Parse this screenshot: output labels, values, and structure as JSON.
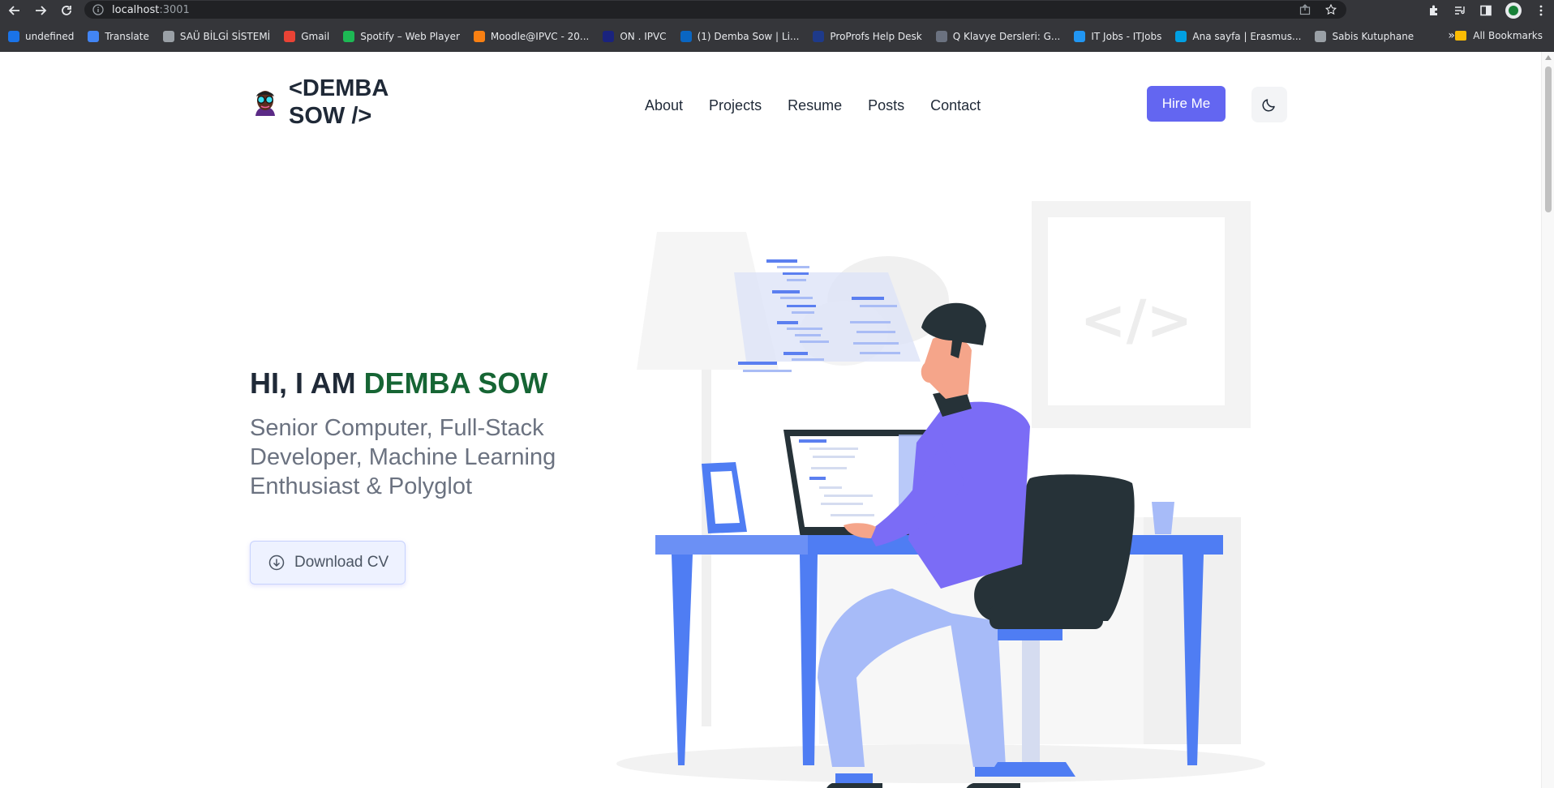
{
  "browser": {
    "url_host": "localhost",
    "url_port": ":3001",
    "bookmarks": [
      {
        "label": "undefined",
        "icon": "infinity-icon",
        "color": "#1a73e8"
      },
      {
        "label": "Translate",
        "icon": "translate-icon",
        "color": "#4285f4"
      },
      {
        "label": "SAÜ BİLGİ SİSTEMİ",
        "icon": "document-icon",
        "color": "#9aa0a6"
      },
      {
        "label": "Gmail",
        "icon": "gmail-icon",
        "color": "#ea4335"
      },
      {
        "label": "Spotify – Web Player",
        "icon": "spotify-icon",
        "color": "#1db954"
      },
      {
        "label": "Moodle@IPVC - 20...",
        "icon": "moodle-icon",
        "color": "#f98012"
      },
      {
        "label": "ON . IPVC",
        "icon": "on-icon",
        "color": "#1a237e"
      },
      {
        "label": "(1) Demba Sow | Li...",
        "icon": "linkedin-icon",
        "color": "#0a66c2"
      },
      {
        "label": "ProProfs Help Desk",
        "icon": "proprofs-icon",
        "color": "#1e3a8a"
      },
      {
        "label": "Q Klavye Dersleri: G...",
        "icon": "drop-icon",
        "color": "#6b7280"
      },
      {
        "label": "IT Jobs - ITJobs",
        "icon": "itjobs-icon",
        "color": "#2196f3"
      },
      {
        "label": "Ana sayfa | Erasmus...",
        "icon": "erasmus-icon",
        "color": "#00a0e3"
      },
      {
        "label": "Sabis Kutuphane",
        "icon": "globe-icon",
        "color": "#9aa0a6"
      }
    ],
    "more_label": "»",
    "all_bookmarks": "All Bookmarks"
  },
  "header": {
    "logo_text": "<DEMBA SOW />",
    "nav": [
      "About",
      "Projects",
      "Resume",
      "Posts",
      "Contact"
    ],
    "hire_label": "Hire Me",
    "theme_icon": "moon-icon"
  },
  "hero": {
    "greeting": "HI, I AM ",
    "name": "DEMBA SOW",
    "subtitle": "Senior Computer, Full-Stack Developer, Machine Learning Enthusiast & Polyglot",
    "download_label": "Download CV",
    "illustration_code_symbol": "</>"
  },
  "colors": {
    "accent": "#6366f1",
    "name_green": "#166534",
    "illustration_blue": "#4f7df3",
    "shirt_purple": "#7b6cf6",
    "chair_dark": "#263238"
  }
}
